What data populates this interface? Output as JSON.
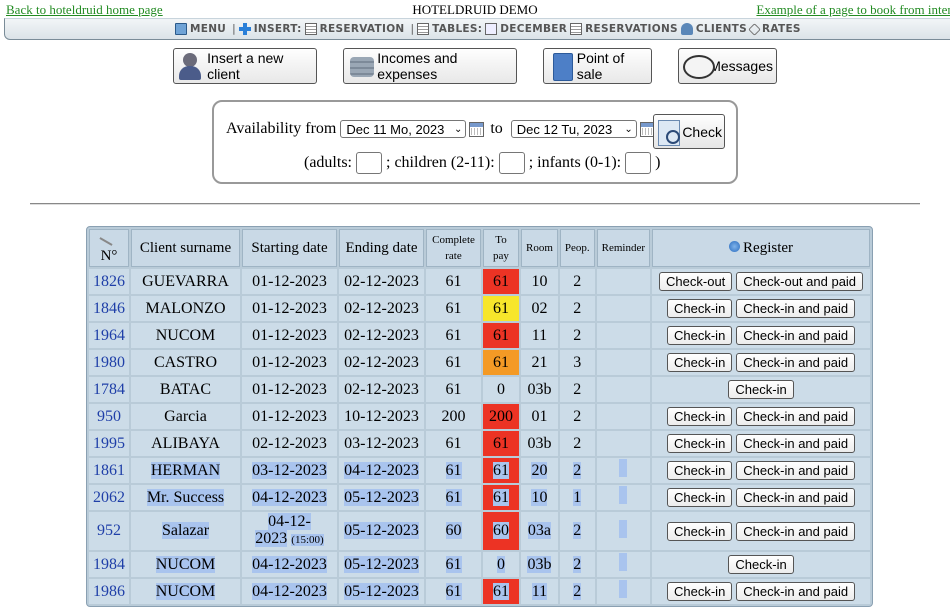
{
  "top": {
    "back_link": "Back to hoteldruid home page",
    "title": "HOTELDRUID DEMO",
    "example_link": "Example of a page to book from interne"
  },
  "menubar": {
    "menu": "MENU",
    "insert": "INSERT:",
    "reservation": "RESERVATION",
    "tables": "TABLES:",
    "december": "DECEMBER",
    "reservations": "RESERVATIONS",
    "clients": "CLIENTS",
    "rates": "RATES"
  },
  "actions": {
    "new_client": "Insert a new client",
    "incomes": "Incomes and expenses",
    "pos": "Point of sale",
    "messages": "Messages"
  },
  "availability": {
    "label_from": "Availability from",
    "from_value": "Dec 11 Mo, 2023",
    "label_to": "to",
    "to_value": "Dec 12 Tu, 2023",
    "check_label": "Check",
    "adults_label": "(adults:",
    "children_label": "; children (2-11):",
    "infants_label": "; infants (0-1):",
    "close_paren": ")"
  },
  "table": {
    "headers": {
      "num": "N°",
      "surname": "Client surname",
      "start": "Starting date",
      "end": "Ending date",
      "rate_line1": "Complete",
      "rate_line2": "rate",
      "topay": "To pay",
      "room": "Room",
      "people": "Peop.",
      "reminder": "Reminder",
      "register": "Register"
    },
    "rows": [
      {
        "id": "1826",
        "surname": "GUEVARRA",
        "start": "01-12-2023",
        "end": "02-12-2023",
        "rate": "61",
        "topay": "61",
        "room": "10",
        "people": "2",
        "btn1": "Check-out",
        "btn2": "Check-out and paid"
      },
      {
        "id": "1846",
        "surname": "MALONZO",
        "start": "01-12-2023",
        "end": "02-12-2023",
        "rate": "61",
        "topay": "61",
        "room": "02",
        "people": "2",
        "btn1": "Check-in",
        "btn2": "Check-in and paid"
      },
      {
        "id": "1964",
        "surname": "NUCOM",
        "start": "01-12-2023",
        "end": "02-12-2023",
        "rate": "61",
        "topay": "61",
        "room": "11",
        "people": "2",
        "btn1": "Check-in",
        "btn2": "Check-in and paid"
      },
      {
        "id": "1980",
        "surname": "CASTRO",
        "start": "01-12-2023",
        "end": "02-12-2023",
        "rate": "61",
        "topay": "61",
        "room": "21",
        "people": "3",
        "btn1": "Check-in",
        "btn2": "Check-in and paid"
      },
      {
        "id": "1784",
        "surname": "BATAC",
        "start": "01-12-2023",
        "end": "02-12-2023",
        "rate": "61",
        "topay": "0",
        "room": "03b",
        "people": "2",
        "btn1": "Check-in"
      },
      {
        "id": "950",
        "surname": "Garcia",
        "start": "01-12-2023",
        "end": "10-12-2023",
        "rate": "200",
        "topay": "200",
        "room": "01",
        "people": "2",
        "btn1": "Check-in",
        "btn2": "Check-in and paid"
      },
      {
        "id": "1995",
        "surname": "ALIBAYA",
        "start": "02-12-2023",
        "end": "03-12-2023",
        "rate": "61",
        "topay": "61",
        "room": "03b",
        "people": "2",
        "btn1": "Check-in",
        "btn2": "Check-in and paid"
      },
      {
        "id": "1861",
        "surname": "HERMAN",
        "start": "03-12-2023",
        "end": "04-12-2023",
        "rate": "61",
        "topay": "61",
        "room": "20",
        "people": "2",
        "btn1": "Check-in",
        "btn2": "Check-in and paid"
      },
      {
        "id": "2062",
        "surname": "Mr. Success",
        "start": "04-12-2023",
        "end": "05-12-2023",
        "rate": "61",
        "topay": "61",
        "room": "10",
        "people": "1",
        "btn1": "Check-in",
        "btn2": "Check-in and paid"
      },
      {
        "id": "952",
        "surname": "Salazar",
        "start_line1": "04-12-",
        "start_line2": "2023",
        "start_time": "(15:00)",
        "end": "05-12-2023",
        "rate": "60",
        "topay": "60",
        "room": "03a",
        "people": "2",
        "btn1": "Check-in",
        "btn2": "Check-in and paid"
      },
      {
        "id": "1984",
        "surname": "NUCOM",
        "start": "04-12-2023",
        "end": "05-12-2023",
        "rate": "61",
        "topay": "0",
        "room": "03b",
        "people": "2",
        "btn1": "Check-in"
      },
      {
        "id": "1986",
        "surname": "NUCOM",
        "start": "04-12-2023",
        "end": "05-12-2023",
        "rate": "61",
        "topay": "61",
        "room": "11",
        "people": "2",
        "btn1": "Check-in",
        "btn2": "Check-in and paid"
      }
    ]
  },
  "colors": {
    "red": "#ec3324",
    "yellow": "#f7e62b",
    "orange": "#f49a25",
    "selection": "#a9c4ee"
  }
}
